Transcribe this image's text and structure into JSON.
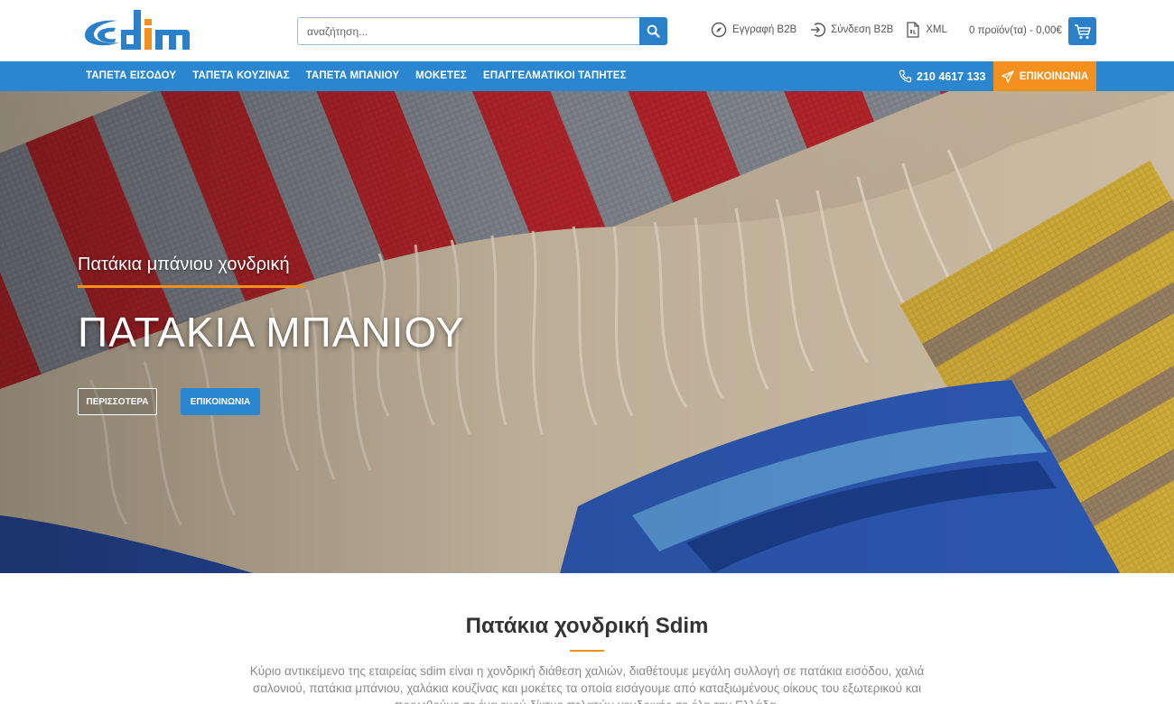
{
  "brand": {
    "logo_text": "sdim",
    "primary_color": "#2a86cf",
    "accent_color": "#f4901e"
  },
  "search": {
    "placeholder": "αναζήτηση...",
    "value": ""
  },
  "toplinks": {
    "register": "Εγγραφή B2B",
    "login": "Σύνδεση B2B",
    "xml": "XML"
  },
  "cart": {
    "summary": "0 προϊόν(τα) - 0,00€"
  },
  "nav": {
    "items": [
      {
        "label": "ΤΑΠΕΤΑ ΕΙΣΟΔΟΥ"
      },
      {
        "label": "ΤΑΠΕΤΑ ΚΟΥΖΙΝΑΣ"
      },
      {
        "label": "ΤΑΠΕΤΑ ΜΠΑΝΙΟΥ"
      },
      {
        "label": "ΜΟΚΕΤΕΣ"
      },
      {
        "label": "ΕΠΑΓΓΕΛΜΑΤΙΚΟΙ ΤΑΠΗΤΕΣ"
      }
    ],
    "phone": "210 4617 133",
    "contact": "ΕΠΙΚΟΙΝΩΝΙΑ"
  },
  "hero": {
    "subtitle": "Πατάκια μπάνιου χονδρική",
    "title": "ΠΑΤΑΚΙΑ ΜΠΑΝΙΟΥ",
    "more_button": "ΠΕΡΙΣΣΟΤΕΡΑ",
    "contact_button": "ΕΠΙΚΟΙΝΩΝΙΑ"
  },
  "intro": {
    "title": "Πατάκια χονδρική Sdim",
    "text": "Κύριο αντικείμενο της εταιρείας sdim είναι η χονδρική διάθεση χαλιών, διαθέτουμε μεγάλη συλλογή σε πατάκια εισόδου, χαλιά σαλονιού, πατάκια μπάνιου, χαλάκια κουζίνας και μοκέτες τα οποία εισάγουμε από καταξιωμένους οίκους του εξωτερικού και προωθούμε σε ένα ευρύ δίκτυο πελατών χονδρικής σε όλη την Ελλάδα."
  }
}
